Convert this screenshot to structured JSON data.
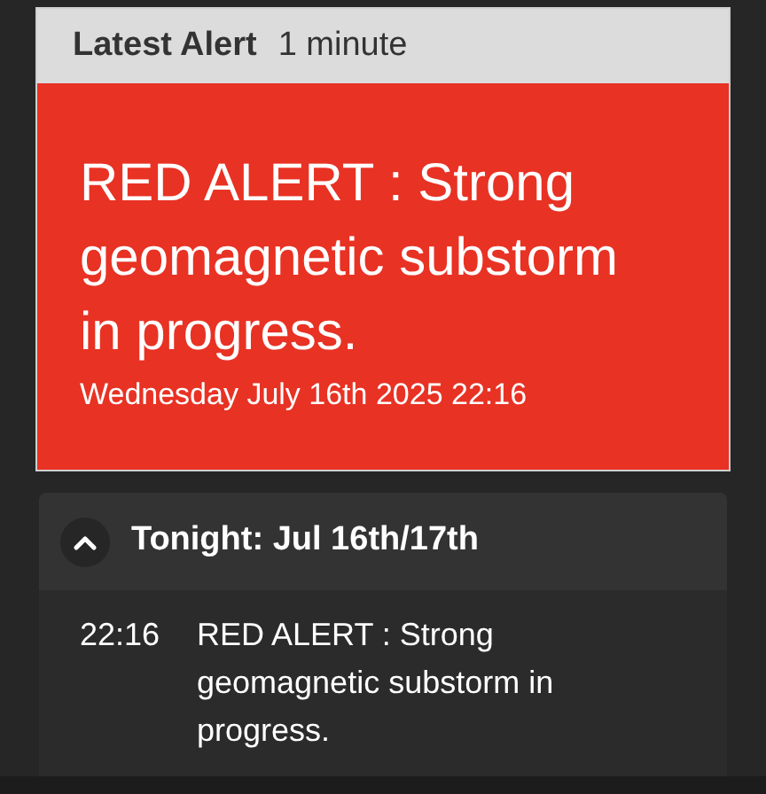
{
  "latest_alert": {
    "label": "Latest Alert",
    "age": "1 minute",
    "message": "RED ALERT : Strong geomagnetic substorm in progress.",
    "date": "Wednesday July 16th 2025 22:16",
    "color": "#e83224"
  },
  "timeline": {
    "title": "Tonight: Jul 16th/17th",
    "expanded": true,
    "entries": [
      {
        "time": "22:16",
        "text": "RED ALERT : Strong geomagnetic substorm in progress."
      }
    ]
  }
}
